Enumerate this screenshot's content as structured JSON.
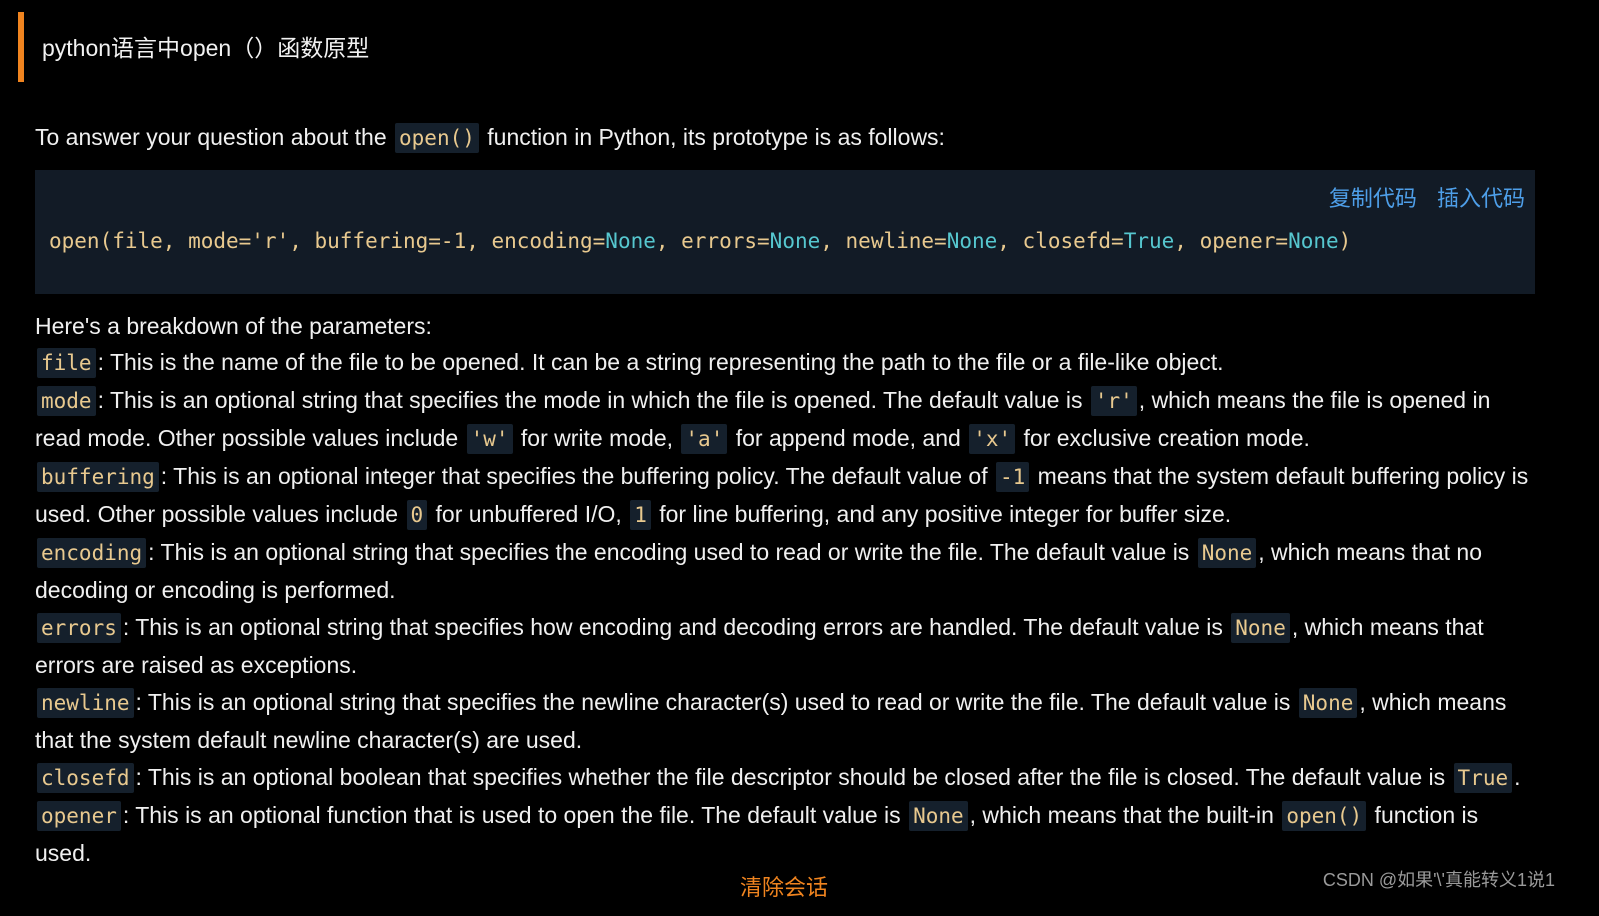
{
  "question": {
    "text": "python语言中open（）函数原型",
    "accent_color": "#f0841f"
  },
  "answer": {
    "intro_before": "To answer your question about the ",
    "intro_code": "open()",
    "intro_after": " function in Python, its prototype is as follows:",
    "code_block": {
      "copy_label": "复制代码",
      "insert_label": "插入代码",
      "code_open": "open(file, mode='r', buffering=-1, encoding=",
      "none1": "None",
      "sep1": ", errors=",
      "none2": "None",
      "sep2": ", newline=",
      "none3": "None",
      "sep3": ", closefd=",
      "true1": "True",
      "sep4": ", opener=",
      "none4": "None",
      "code_close": ")"
    },
    "params_heading": "Here's a breakdown of the parameters:",
    "params": {
      "file": {
        "name": "file",
        "t1": ": This is the name of the file to be opened. It can be a string representing the path to the file or a file-like object."
      },
      "mode": {
        "name": "mode",
        "t1": ": This is an optional string that specifies the mode in which the file is opened. The default value is ",
        "c1": "'r'",
        "t2": ", which means the file is opened in read mode. Other possible values include ",
        "c2": "'w'",
        "t3": " for write mode, ",
        "c3": "'a'",
        "t4": " for append mode, and ",
        "c4": "'x'",
        "t5": " for exclusive creation mode."
      },
      "buffering": {
        "name": "buffering",
        "t1": ": This is an optional integer that specifies the buffering policy. The default value of ",
        "c1": "-1",
        "t2": " means that the system default buffering policy is used. Other possible values include ",
        "c2": "0",
        "t3": " for unbuffered I/O, ",
        "c3": "1",
        "t4": " for line buffering, and any positive integer for buffer size."
      },
      "encoding": {
        "name": "encoding",
        "t1": ": This is an optional string that specifies the encoding used to read or write the file. The default value is ",
        "c1": "None",
        "t2": ", which means that no decoding or encoding is performed."
      },
      "errors": {
        "name": "errors",
        "t1": ": This is an optional string that specifies how encoding and decoding errors are handled. The default value is ",
        "c1": "None",
        "t2": ", which means that errors are raised as exceptions."
      },
      "newline": {
        "name": "newline",
        "t1": ": This is an optional string that specifies the newline character(s) used to read or write the file. The default value is ",
        "c1": "None",
        "t2": ", which means that the system default newline character(s) are used."
      },
      "closefd": {
        "name": "closefd",
        "t1": ": This is an optional boolean that specifies whether the file descriptor should be closed after the file is closed. The default value is ",
        "c1": "True",
        "t2": "."
      },
      "opener": {
        "name": "opener",
        "t1": ": This is an optional function that is used to open the file. The default value is ",
        "c1": "None",
        "t2": ", which means that the built-in ",
        "c2": "open()",
        "t3": " function is used."
      }
    }
  },
  "footer": {
    "clear_label": "清除会话",
    "watermark": "CSDN @如果'\\'真能转义1说1"
  },
  "colors": {
    "background": "#000000",
    "code_bg": "#121b26",
    "inline_code_bg": "#15202c",
    "code_text": "#e8c98f",
    "keyword": "#56c7cf",
    "link_blue": "#4e9fe9",
    "orange": "#f0841f"
  }
}
